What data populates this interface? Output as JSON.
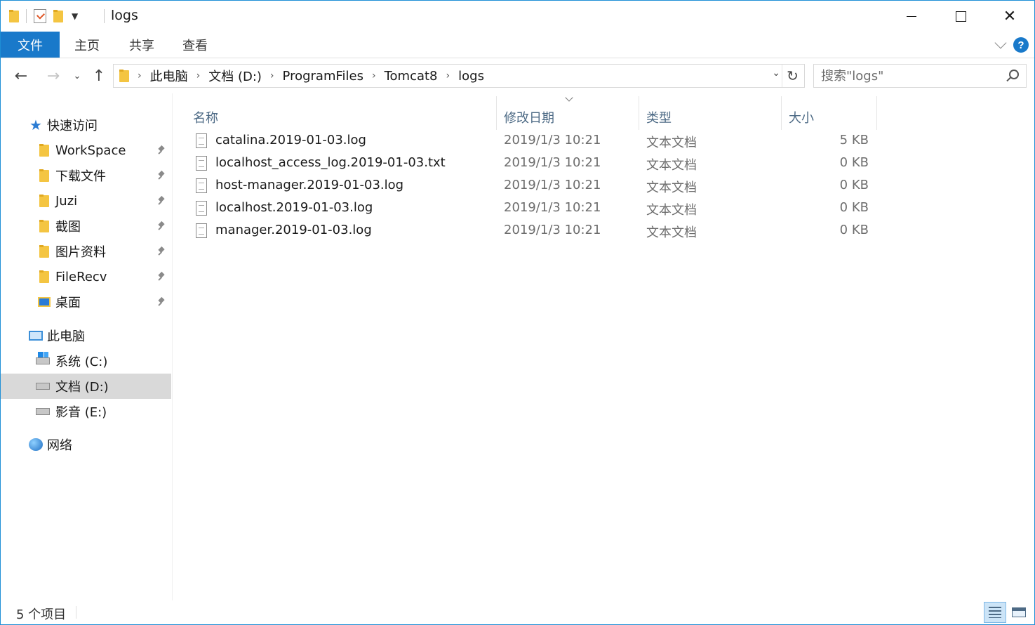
{
  "window": {
    "title": "logs"
  },
  "ribbon": {
    "tabs": [
      "文件",
      "主页",
      "共享",
      "查看"
    ]
  },
  "address": {
    "crumbs": [
      "此电脑",
      "文档 (D:)",
      "ProgramFiles",
      "Tomcat8",
      "logs"
    ]
  },
  "search": {
    "placeholder": "搜索\"logs\""
  },
  "sidebar": {
    "quick_access": "快速访问",
    "pinned": [
      "WorkSpace",
      "下载文件",
      "Juzi",
      "截图",
      "图片资料",
      "FileRecv",
      "桌面"
    ],
    "this_pc": "此电脑",
    "drives": [
      "系统 (C:)",
      "文档 (D:)",
      "影音 (E:)"
    ],
    "network": "网络"
  },
  "columns": {
    "name": "名称",
    "date": "修改日期",
    "type": "类型",
    "size": "大小"
  },
  "files": [
    {
      "name": "catalina.2019-01-03.log",
      "date": "2019/1/3 10:21",
      "type": "文本文档",
      "size": "5 KB"
    },
    {
      "name": "localhost_access_log.2019-01-03.txt",
      "date": "2019/1/3 10:21",
      "type": "文本文档",
      "size": "0 KB"
    },
    {
      "name": "host-manager.2019-01-03.log",
      "date": "2019/1/3 10:21",
      "type": "文本文档",
      "size": "0 KB"
    },
    {
      "name": "localhost.2019-01-03.log",
      "date": "2019/1/3 10:21",
      "type": "文本文档",
      "size": "0 KB"
    },
    {
      "name": "manager.2019-01-03.log",
      "date": "2019/1/3 10:21",
      "type": "文本文档",
      "size": "0 KB"
    }
  ],
  "status": {
    "count": "5 个项目"
  },
  "colors": {
    "accent": "#1979ca",
    "selected": "#d9d9d9",
    "header_text": "#4d6a85"
  }
}
